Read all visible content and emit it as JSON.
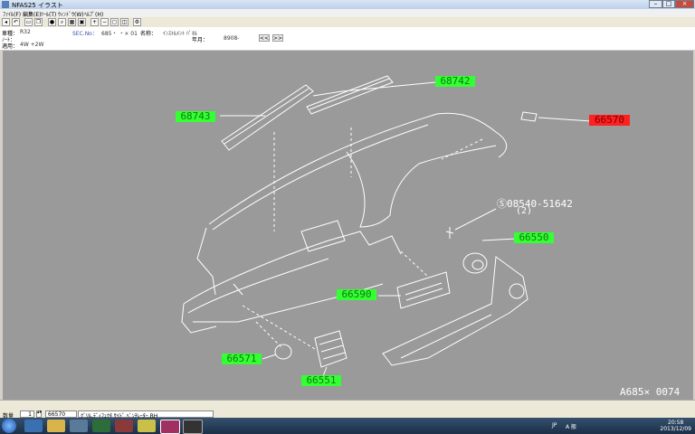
{
  "window": {
    "title": "NFAS25 イラスト"
  },
  "menu": [
    "ﾌｧｲﾙ(F)",
    "編集(E)",
    "ﾂｰﾙ(T)",
    "ｳｨﾝﾄﾞｳ(W)",
    "ﾍﾙﾌﾟ(H)"
  ],
  "info": {
    "model_label": "車種：",
    "model_value": "R32",
    "note_label": "ﾉｰﾄ：",
    "apply_label": "適用：",
    "apply_value": "4W +2W",
    "sec_label": "SEC.No：",
    "sec_value": "685・ ・× 01",
    "name_label": "名称：",
    "name_value": "ｲﾝｽﾄﾙﾒﾝﾄ ﾊﾟﾈﾙ",
    "year_label": "年月：",
    "year_value": "8908-",
    "prev_label": "<<",
    "next_label": ">>"
  },
  "diagram": {
    "parts": [
      {
        "label": "68742",
        "status": "normal"
      },
      {
        "label": "68743",
        "status": "normal"
      },
      {
        "label": "66570",
        "status": "selected"
      },
      {
        "label": "66550",
        "status": "normal"
      },
      {
        "label": "66590",
        "status": "normal"
      },
      {
        "label": "66571",
        "status": "normal"
      },
      {
        "label": "66551",
        "status": "normal"
      }
    ],
    "bolt_label": "Ⓢ08540-51642",
    "bolt_qty": "(2)",
    "figure_code": "A685× 0074",
    "colors": {
      "normal": "#33ff33",
      "selected": "#ff2020",
      "background": "#9a9a9a"
    }
  },
  "status": {
    "qty_label": "数量",
    "qty_value": "1",
    "part_no": "66570",
    "part_name": "ｸﾞﾘﾙ,ﾃﾞｨﾌｪｸﾀ ｻｲﾄﾞ ﾍﾞﾝﾁﾚｰﾀｰ RH"
  },
  "taskbar": {
    "time": "20:58",
    "date": "2013/12/09",
    "lang": "JP",
    "ime": "A 般"
  }
}
